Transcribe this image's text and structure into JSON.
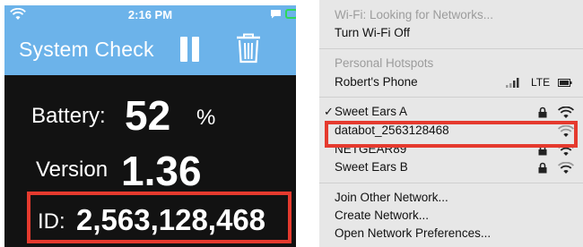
{
  "phone": {
    "status": {
      "time": "2:16 PM"
    },
    "app_title": "System Check",
    "battery": {
      "label": "Battery:",
      "value": "52",
      "unit": "%"
    },
    "version": {
      "label": "Version",
      "value": "1.36"
    },
    "id": {
      "label": "ID:",
      "value": "2,563,128,468"
    }
  },
  "wifi_menu": {
    "status": "Wi-Fi: Looking for Networks...",
    "toggle": "Turn Wi-Fi Off",
    "hotspots_header": "Personal Hotspots",
    "hotspot": {
      "name": "Robert's Phone",
      "network_type": "LTE"
    },
    "networks": [
      {
        "name": "Sweet Ears A",
        "connected": true,
        "locked": true
      },
      {
        "name": "databot_2563128468",
        "connected": false,
        "locked": false
      },
      {
        "name": "NETGEAR89",
        "connected": false,
        "locked": true
      },
      {
        "name": "Sweet Ears B",
        "connected": false,
        "locked": true
      }
    ],
    "actions": [
      "Join Other Network...",
      "Create Network...",
      "Open Network Preferences..."
    ]
  },
  "colors": {
    "header": "#6cb3ea",
    "highlight": "#e53a2e",
    "phone_background": "#121212",
    "menu_background": "#e7e7e7"
  }
}
